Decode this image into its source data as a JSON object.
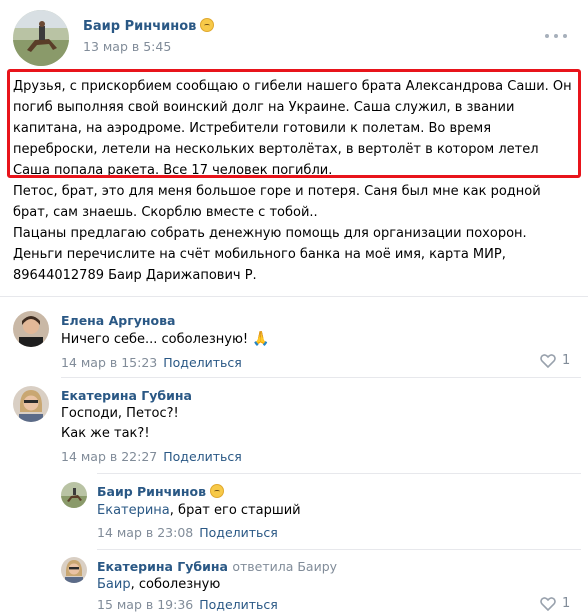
{
  "post": {
    "author": "Баир Ринчинов",
    "date": "13 мар в 5:45",
    "paragraphs": [
      "Друзья, с прискорбием сообщаю о гибели нашего брата Александрова Саши. Он погиб выполняя свой воинский долг на Украине. Саша служил, в звании капитана, на аэродроме. Истребители готовили к полетам. Во время переброски, летели на нескольких вертолётах, в вертолёт в котором летел Саша попала ракета. Все 17 человек погибли.",
      "Петос, брат, это для меня большое горе и потеря. Саня был мне как родной брат, сам знаешь. Скорблю вместе с тобой..",
      "Пацаны предлагаю собрать денежную помощь для организации похорон. Деньги перечислите на счёт мобильного банка на моё имя, карта МИР, 89644012789 Баир Дарижапович Р."
    ],
    "highlight_color": "#e8141b"
  },
  "comments": [
    {
      "author": "Елена Аргунова",
      "lines": [
        "Ничего себе... соболезную!"
      ],
      "emoji": "🙏",
      "date": "14 мар в 15:23",
      "share": "Поделиться",
      "likes": "1"
    },
    {
      "author": "Екатерина Губина",
      "lines": [
        "Господи, Петос?!",
        "Как же так?!"
      ],
      "date": "14 мар в 22:27",
      "share": "Поделиться"
    },
    {
      "author": "Баир Ринчинов",
      "addressee": "Екатерина",
      "text_rest": ", брат его старший",
      "date": "14 мар в 23:08",
      "share": "Поделиться"
    },
    {
      "author": "Екатерина Губина",
      "replied_to": "ответила Баиру",
      "addressee": "Баир",
      "text_rest": ", соболезную",
      "date": "15 мар в 19:36",
      "share": "Поделиться",
      "likes": "1"
    }
  ],
  "colors": {
    "link": "#2a5885",
    "meta": "#818c99",
    "divider": "#e7e8ec"
  }
}
